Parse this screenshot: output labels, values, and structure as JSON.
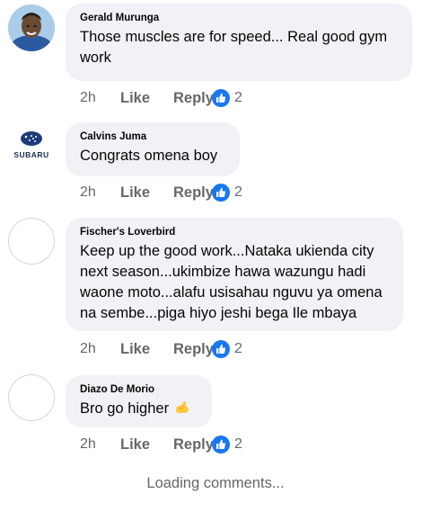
{
  "comments": [
    {
      "author": "Gerald Murunga",
      "lines": [
        "Those muscles are for speed... Real good gym",
        "work"
      ],
      "time": "2h",
      "like_label": "Like",
      "reply_label": "Reply",
      "reaction_icon": "like-reaction-icon",
      "reactions": "2",
      "avatar": "profile-photo"
    },
    {
      "author": "Calvins Juma",
      "lines": [
        "Congrats omena boy"
      ],
      "time": "2h",
      "like_label": "Like",
      "reply_label": "Reply",
      "reaction_icon": "like-reaction-icon",
      "reactions": "2",
      "avatar": "subaru-logo",
      "avatar_text": "SUBARU"
    },
    {
      "author": "Fischer's Loverbird",
      "lines": [
        "Keep up the good work...Nataka ukienda city",
        "next season...ukimbize hawa wazungu hadi",
        "waone moto...alafu usisahau nguvu ya omena",
        "na sembe...piga hiyo jeshi bega Ile mbaya"
      ],
      "time": "2h",
      "like_label": "Like",
      "reply_label": "Reply",
      "reaction_icon": "like-reaction-icon",
      "reactions": "2",
      "avatar": "empty"
    },
    {
      "author": "Diazo De Morio",
      "lines": [
        "Bro go higher"
      ],
      "emoji": "flexed-biceps-icon",
      "time": "2h",
      "like_label": "Like",
      "reply_label": "Reply",
      "reaction_icon": "like-reaction-icon",
      "reactions": "2",
      "avatar": "empty"
    }
  ],
  "loading_text": "Loading comments...",
  "colors": {
    "bubble": "#f0f2f5",
    "meta": "#65676b",
    "like_blue": "#1877f2",
    "text": "#050505"
  }
}
